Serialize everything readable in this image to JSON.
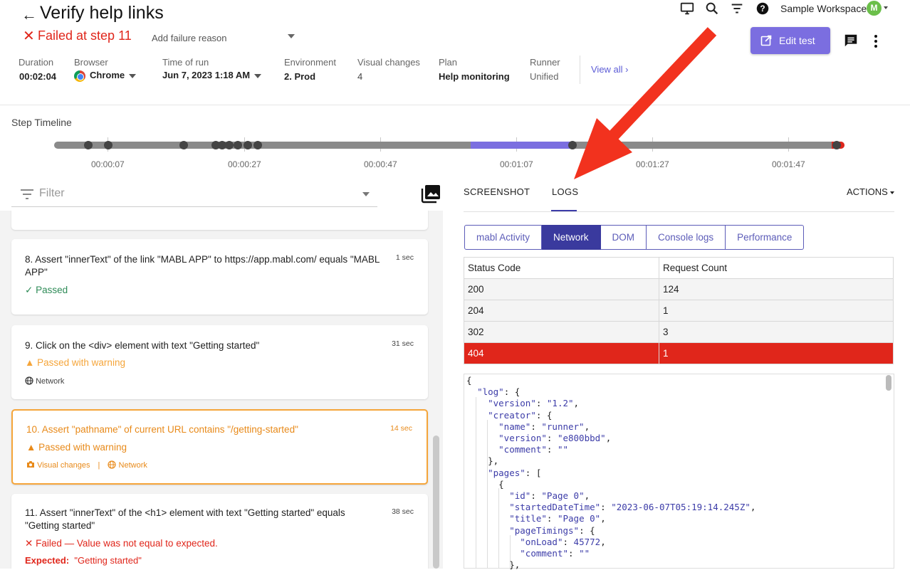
{
  "header": {
    "title": "Verify help links",
    "failure": "Failed at step 11",
    "failure_reason_placeholder": "Add failure reason",
    "meta": {
      "duration_label": "Duration",
      "duration": "00:02:04",
      "browser_label": "Browser",
      "browser": "Chrome",
      "time_label": "Time of run",
      "time": "Jun 7, 2023 1:18 AM",
      "env_label": "Environment",
      "env": "2. Prod",
      "visual_label": "Visual changes",
      "visual": "4",
      "plan_label": "Plan",
      "plan": "Help monitoring",
      "runner_label": "Runner",
      "runner": "Unified"
    },
    "view_all": "View all",
    "workspace": "Sample Workspace",
    "avatar_letter": "M",
    "edit_button": "Edit test"
  },
  "timeline": {
    "label": "Step Timeline",
    "times": [
      "00:00:07",
      "00:00:27",
      "00:00:47",
      "00:01:07",
      "00:01:27",
      "00:01:47"
    ]
  },
  "filter": {
    "placeholder": "Filter"
  },
  "steps": [
    {
      "title": "8. Assert \"innerText\" of the link \"MABL APP\" to https://app.mabl.com/ equals \"MABL APP\"",
      "duration": "1 sec",
      "status": "Passed"
    },
    {
      "title": "9. Click on the <div> element with text \"Getting started\"",
      "duration": "31 sec",
      "status": "Passed with warning",
      "tags": [
        "Network"
      ]
    },
    {
      "title": "10. Assert \"pathname\" of current URL contains \"/getting-started\"",
      "duration": "14 sec",
      "status": "Passed with warning",
      "tags": [
        "Visual changes",
        "Network"
      ]
    },
    {
      "title": "11. Assert \"innerText\" of the <h1> element with text \"Getting started\" equals \"Getting started\"",
      "duration": "38 sec",
      "status": "Failed — Value was not equal to expected.",
      "expected_label": "Expected:",
      "expected_value": "\"Getting started\""
    }
  ],
  "right": {
    "tabs": [
      "SCREENSHOT",
      "LOGS"
    ],
    "actions": "ACTIONS",
    "log_tabs": [
      "mabl Activity",
      "Network",
      "DOM",
      "Console logs",
      "Performance"
    ],
    "table": {
      "headers": [
        "Status Code",
        "Request Count"
      ],
      "rows": [
        [
          "200",
          "124"
        ],
        [
          "204",
          "1"
        ],
        [
          "302",
          "3"
        ],
        [
          "404",
          "1"
        ]
      ]
    },
    "json_lines": [
      "{",
      "  \"log\": {",
      "    \"version\": \"1.2\",",
      "    \"creator\": {",
      "      \"name\": \"runner\",",
      "      \"version\": \"e800bbd\",",
      "      \"comment\": \"\"",
      "    },",
      "    \"pages\": [",
      "      {",
      "        \"id\": \"Page 0\",",
      "        \"startedDateTime\": \"2023-06-07T05:19:14.245Z\",",
      "        \"title\": \"Page 0\",",
      "        \"pageTimings\": {",
      "          \"onLoad\": 45772,",
      "          \"comment\": \"\"",
      "        },"
    ]
  },
  "colors": {
    "accent": "#7b6ee0",
    "error": "#e0261b",
    "warning": "#f5a53a",
    "success": "#2e8b57",
    "nav": "#3a3a9e"
  }
}
